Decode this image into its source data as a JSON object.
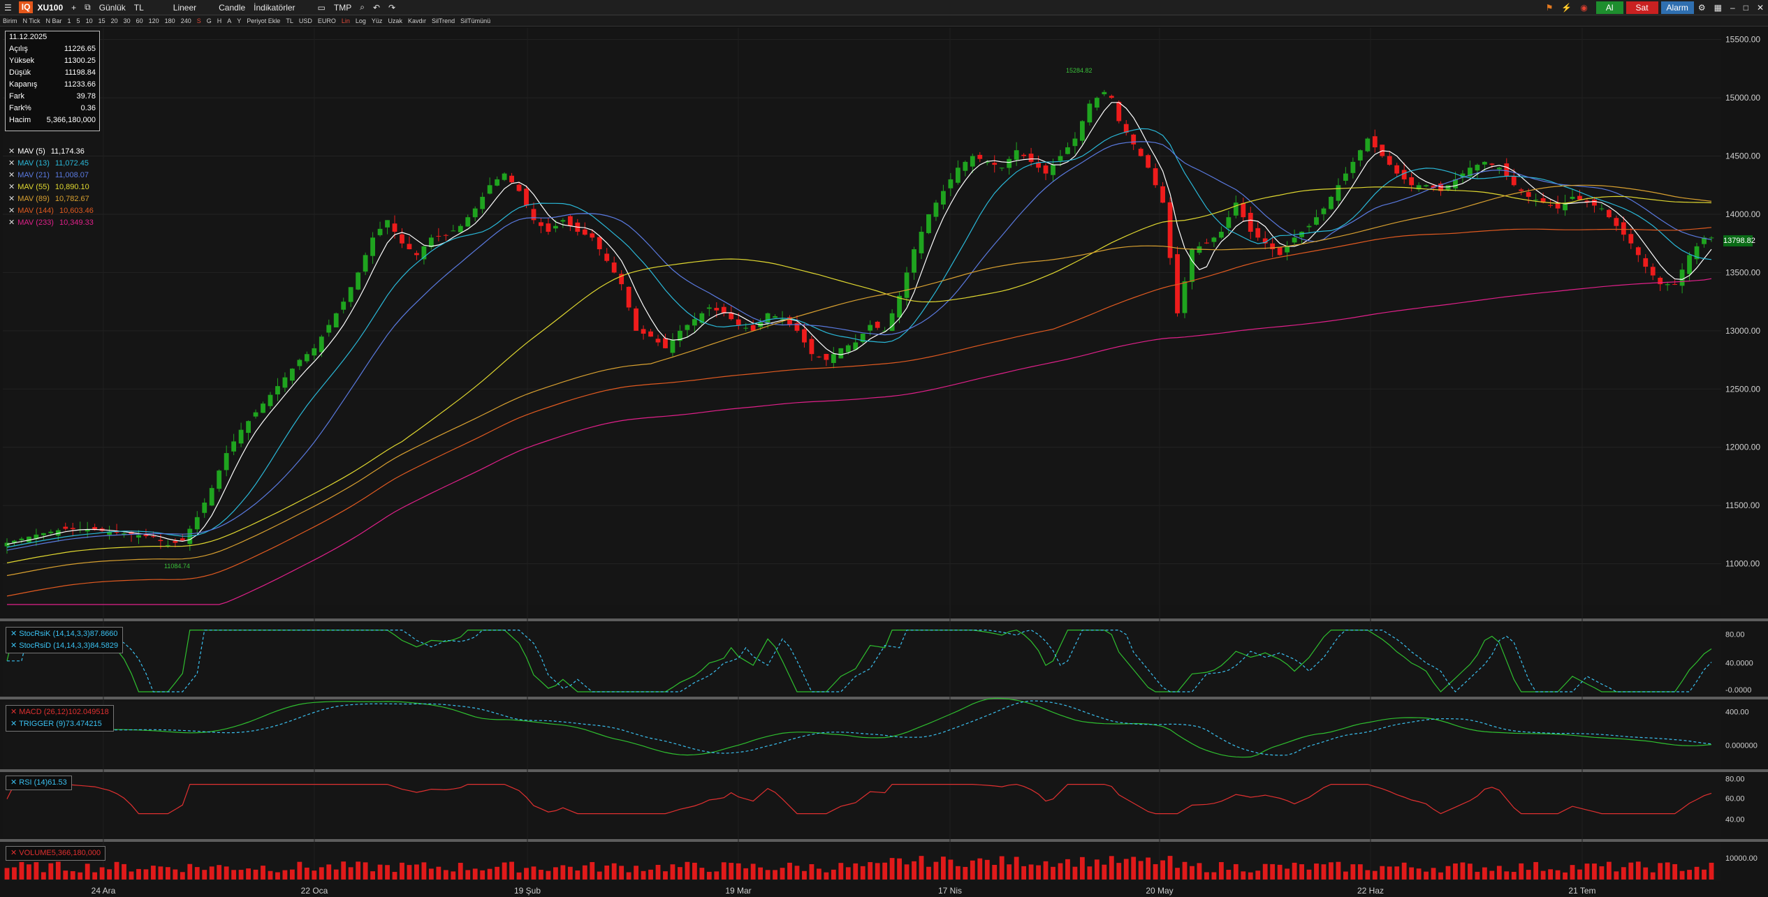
{
  "toolbar": {
    "logo": "IQ",
    "symbol": "XU100",
    "period": "Günlük",
    "currency": "TL",
    "scale": "Lineer",
    "chart_type": "Candle",
    "indicators": "İndikatörler",
    "tmp": "TMP",
    "buy": "Al",
    "sell": "Sat",
    "alarm": "Alarm"
  },
  "subbar": [
    "Birim",
    "N Tick",
    "N Bar",
    "1",
    "5",
    "10",
    "15",
    "20",
    "30",
    "60",
    "120",
    "180",
    "240",
    "S",
    "G",
    "H",
    "A",
    "Y",
    "Periyot Ekle",
    "TL",
    "USD",
    "EURO",
    "Lin",
    "Log",
    "Yüz",
    "Uzak",
    "Kavdır",
    "SilTrend",
    "SilTümünü"
  ],
  "info": {
    "date": "11.12.2025",
    "rows": [
      {
        "label": "Açılış",
        "value": "11226.65"
      },
      {
        "label": "Yüksek",
        "value": "11300.25"
      },
      {
        "label": "Düşük",
        "value": "11198.84"
      },
      {
        "label": "Kapanış",
        "value": "11233.66"
      },
      {
        "label": "Fark",
        "value": "39.78"
      },
      {
        "label": "Fark%",
        "value": "0.36"
      },
      {
        "label": "Hacim",
        "value": "5,366,180,000"
      }
    ]
  },
  "ma_legend": [
    {
      "name": "MAV (5)",
      "value": "11,174.36",
      "color": "#ffffff"
    },
    {
      "name": "MAV (13)",
      "value": "11,072.45",
      "color": "#2ab8d8"
    },
    {
      "name": "MAV (21)",
      "value": "11,008.07",
      "color": "#5a7ae0"
    },
    {
      "name": "MAV (55)",
      "value": "10,890.10",
      "color": "#e0d830"
    },
    {
      "name": "MAV (89)",
      "value": "10,782.67",
      "color": "#d8a030"
    },
    {
      "name": "MAV (144)",
      "value": "10,603.46",
      "color": "#e05a20"
    },
    {
      "name": "MAV (233)",
      "value": "10,349.33",
      "color": "#e0208a"
    }
  ],
  "last_price": "13798.82",
  "price_box_low": "11084.74",
  "price_box_high": "15284.82",
  "indicators": {
    "stoch": [
      {
        "name": "StocRsiK (14,14,3,3)",
        "value": "87.8660"
      },
      {
        "name": "StocRsiD (14,14,3,3)",
        "value": "84.5829"
      }
    ],
    "macd": [
      {
        "name": "MACD (26,12)",
        "value": "102.049518"
      },
      {
        "name": "TRIGGER (9)",
        "value": "73.474215"
      }
    ],
    "rsi": [
      {
        "name": "RSI (14)",
        "value": "61.53"
      }
    ],
    "volume": [
      {
        "name": "VOLUME",
        "value": "5,366,180,000"
      }
    ]
  },
  "axes": {
    "price_ticks": [
      "15500.00",
      "15000.00",
      "14500.00",
      "14000.00",
      "13500.00",
      "13000.00",
      "12500.00",
      "12000.00",
      "11500.00",
      "11000.00"
    ],
    "stoch_ticks": [
      "80.00",
      "40.0000",
      "-0.0000"
    ],
    "macd_ticks": [
      "400.00",
      "0.000000"
    ],
    "rsi_ticks": [
      "80.00",
      "60.00",
      "40.00"
    ],
    "vol_ticks": [
      "10000.00"
    ],
    "dates": [
      "24 Ara",
      "22 Oca",
      "19 Şub",
      "19 Mar",
      "17 Nis",
      "20 May",
      "22 Haz",
      "21 Tem"
    ]
  },
  "chart_data": {
    "type": "candlestick",
    "ylim": [
      10650,
      15600
    ],
    "x": [
      "24 Ara",
      "22 Oca",
      "19 Şub",
      "19 Mar",
      "17 Nis",
      "20 May",
      "22 Haz",
      "21 Tem"
    ],
    "close_path": [
      [
        0,
        11180
      ],
      [
        4,
        11250
      ],
      [
        8,
        11300
      ],
      [
        12,
        11290
      ],
      [
        16,
        11260
      ],
      [
        20,
        11230
      ],
      [
        22,
        11160
      ],
      [
        24,
        11200
      ],
      [
        26,
        11400
      ],
      [
        28,
        11650
      ],
      [
        30,
        11950
      ],
      [
        32,
        12150
      ],
      [
        34,
        12300
      ],
      [
        36,
        12450
      ],
      [
        38,
        12600
      ],
      [
        40,
        12750
      ],
      [
        42,
        12850
      ],
      [
        44,
        13050
      ],
      [
        46,
        13250
      ],
      [
        48,
        13500
      ],
      [
        50,
        13800
      ],
      [
        52,
        13950
      ],
      [
        54,
        13750
      ],
      [
        56,
        13650
      ],
      [
        58,
        13800
      ],
      [
        60,
        13820
      ],
      [
        62,
        13900
      ],
      [
        64,
        14050
      ],
      [
        66,
        14250
      ],
      [
        68,
        14350
      ],
      [
        70,
        14200
      ],
      [
        72,
        13950
      ],
      [
        74,
        13850
      ],
      [
        76,
        13950
      ],
      [
        78,
        13850
      ],
      [
        80,
        13800
      ],
      [
        82,
        13600
      ],
      [
        84,
        13400
      ],
      [
        86,
        13000
      ],
      [
        88,
        12950
      ],
      [
        90,
        12850
      ],
      [
        92,
        13000
      ],
      [
        94,
        13100
      ],
      [
        96,
        13200
      ],
      [
        98,
        13150
      ],
      [
        100,
        13050
      ],
      [
        102,
        13000
      ],
      [
        104,
        13150
      ],
      [
        106,
        13100
      ],
      [
        108,
        13000
      ],
      [
        110,
        12800
      ],
      [
        112,
        12750
      ],
      [
        114,
        12850
      ],
      [
        116,
        12900
      ],
      [
        118,
        13050
      ],
      [
        120,
        13000
      ],
      [
        122,
        13300
      ],
      [
        124,
        13700
      ],
      [
        126,
        14000
      ],
      [
        128,
        14200
      ],
      [
        130,
        14400
      ],
      [
        132,
        14500
      ],
      [
        134,
        14450
      ],
      [
        136,
        14400
      ],
      [
        138,
        14550
      ],
      [
        140,
        14450
      ],
      [
        142,
        14350
      ],
      [
        144,
        14500
      ],
      [
        146,
        14650
      ],
      [
        148,
        14950
      ],
      [
        150,
        15050
      ],
      [
        151,
        15000
      ],
      [
        152,
        14800
      ],
      [
        154,
        14600
      ],
      [
        156,
        14400
      ],
      [
        158,
        14100
      ],
      [
        160,
        13150
      ],
      [
        162,
        13700
      ],
      [
        164,
        13750
      ],
      [
        166,
        13850
      ],
      [
        168,
        14100
      ],
      [
        170,
        13850
      ],
      [
        172,
        13750
      ],
      [
        174,
        13650
      ],
      [
        176,
        13800
      ],
      [
        178,
        13900
      ],
      [
        180,
        14050
      ],
      [
        182,
        14250
      ],
      [
        184,
        14450
      ],
      [
        186,
        14650
      ],
      [
        188,
        14500
      ],
      [
        190,
        14350
      ],
      [
        192,
        14250
      ],
      [
        194,
        14250
      ],
      [
        196,
        14200
      ],
      [
        198,
        14300
      ],
      [
        200,
        14400
      ],
      [
        202,
        14450
      ],
      [
        204,
        14400
      ],
      [
        206,
        14250
      ],
      [
        208,
        14150
      ],
      [
        210,
        14100
      ],
      [
        212,
        14050
      ],
      [
        214,
        14150
      ],
      [
        216,
        14100
      ],
      [
        218,
        14050
      ],
      [
        220,
        13900
      ],
      [
        222,
        13750
      ],
      [
        224,
        13550
      ],
      [
        226,
        13400
      ],
      [
        228,
        13400
      ],
      [
        230,
        13650
      ],
      [
        232,
        13800
      ]
    ],
    "last_close": 13798.82
  }
}
